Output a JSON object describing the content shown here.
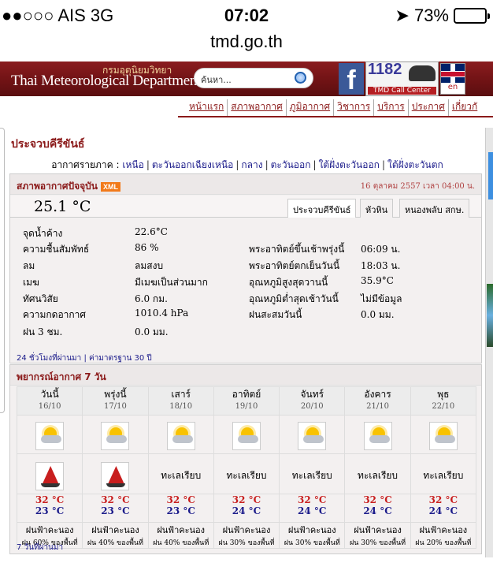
{
  "status_bar": {
    "carrier": "●●○○○ AIS   3G",
    "time": "07:02",
    "battery": "73%",
    "battery_level": 0.73,
    "location_icon": "location-arrow-icon",
    "battery_icon": "battery-icon"
  },
  "browser": {
    "url": "tmd.go.th"
  },
  "header": {
    "thai_name": "กรมอุตุนิยมวิทยา",
    "english_name": "Thai Meteorological Department",
    "search_placeholder": "ค้นหา...",
    "facebook_icon": "facebook-icon",
    "call_number": "1182",
    "call_label": "TMD Call Center",
    "lang_label": "en"
  },
  "nav": [
    "หน้าแรก",
    "สภาพอากาศ",
    "ภูมิอากาศ",
    "วิชาการ",
    "บริการ",
    "ประกาศ",
    "เกี่ยวกั"
  ],
  "page": {
    "province": "ประจวบคีรีขันธ์",
    "regions_label": "อากาศรายภาค :",
    "regions": [
      "เหนือ",
      "ตะวันออกเฉียงเหนือ",
      "กลาง",
      "ตะวันออก",
      "ใต้ฝั่งตะวันออก",
      "ใต้ฝั่งตะวันตก"
    ]
  },
  "current": {
    "title": "สภาพอากาศปัจจุบัน",
    "xml": "XML",
    "datetime": "16 ตุลาคม 2557 เวลา 04:00 น.",
    "temperature": "25.1 °C",
    "station_tabs": [
      "ประจวบคีรีขันธ์",
      "หัวหิน",
      "หนองพลับ สกษ."
    ],
    "left": [
      {
        "label": "จุดน้ำค้าง",
        "value": "22.6°C"
      },
      {
        "label": "ความชื้นสัมพัทธ์",
        "value": "86 %"
      },
      {
        "label": "ลม",
        "value": "ลมสงบ"
      },
      {
        "label": "เมฆ",
        "value": "มีเมฆเป็นส่วนมาก"
      },
      {
        "label": "ทัศนวิสัย",
        "value": "6.0 กม."
      },
      {
        "label": "ความกดอากาศ",
        "value": "1010.4 hPa"
      },
      {
        "label": "ฝน 3 ชม.",
        "value": "0.0 มม."
      }
    ],
    "right": [
      {
        "label": "พระอาทิตย์ขึ้นเช้าพรุ่งนี้",
        "value": "06:09 น."
      },
      {
        "label": "พระอาทิตย์ตกเย็นวันนี้",
        "value": "18:03 น."
      },
      {
        "label": "อุณหภูมิสูงสุดวานนี้",
        "value": "35.9°C"
      },
      {
        "label": "อุณหภูมิต่ำสุดเช้าวันนี้",
        "value": "ไม่มีข้อมูล"
      },
      {
        "label": "ฝนสะสมวันนี้",
        "value": "0.0 มม."
      }
    ],
    "footer_links": [
      "24 ชั่วโมงที่ผ่านมา",
      "ค่ามาตรฐาน 30 ปี"
    ]
  },
  "forecast": {
    "title": "พยากรณ์อากาศ 7 วัน",
    "days": [
      {
        "day": "วันนี้",
        "date": "16/10",
        "sea": "rough",
        "sea_text": "",
        "max": "32 °C",
        "min": "23 °C",
        "desc": "ฝนฟ้าคะนอง",
        "rain": "ฝน 60% ของพื้นที่"
      },
      {
        "day": "พรุ่งนี้",
        "date": "17/10",
        "sea": "rough",
        "sea_text": "",
        "max": "32 °C",
        "min": "23 °C",
        "desc": "ฝนฟ้าคะนอง",
        "rain": "ฝน 40% ของพื้นที่"
      },
      {
        "day": "เสาร์",
        "date": "18/10",
        "sea": "calm",
        "sea_text": "ทะเลเรียบ",
        "max": "32 °C",
        "min": "23 °C",
        "desc": "ฝนฟ้าคะนอง",
        "rain": "ฝน 40% ของพื้นที่"
      },
      {
        "day": "อาทิตย์",
        "date": "19/10",
        "sea": "calm",
        "sea_text": "ทะเลเรียบ",
        "max": "32 °C",
        "min": "24 °C",
        "desc": "ฝนฟ้าคะนอง",
        "rain": "ฝน 30% ของพื้นที่"
      },
      {
        "day": "จันทร์",
        "date": "20/10",
        "sea": "calm",
        "sea_text": "ทะเลเรียบ",
        "max": "32 °C",
        "min": "24 °C",
        "desc": "ฝนฟ้าคะนอง",
        "rain": "ฝน 30% ของพื้นที่"
      },
      {
        "day": "อังคาร",
        "date": "21/10",
        "sea": "calm",
        "sea_text": "ทะเลเรียบ",
        "max": "32 °C",
        "min": "24 °C",
        "desc": "ฝนฟ้าคะนอง",
        "rain": "ฝน 30% ของพื้นที่"
      },
      {
        "day": "พุธ",
        "date": "22/10",
        "sea": "calm",
        "sea_text": "ทะเลเรียบ",
        "max": "32 °C",
        "min": "24 °C",
        "desc": "ฝนฟ้าคะนอง",
        "rain": "ฝน 20% ของพื้นที่"
      }
    ],
    "footer_link": "7 วันที่ผ่านมา"
  },
  "colors": {
    "brand": "#8b1a1a",
    "max_temp": "#c81e1e",
    "min_temp": "#1a1a8a"
  }
}
